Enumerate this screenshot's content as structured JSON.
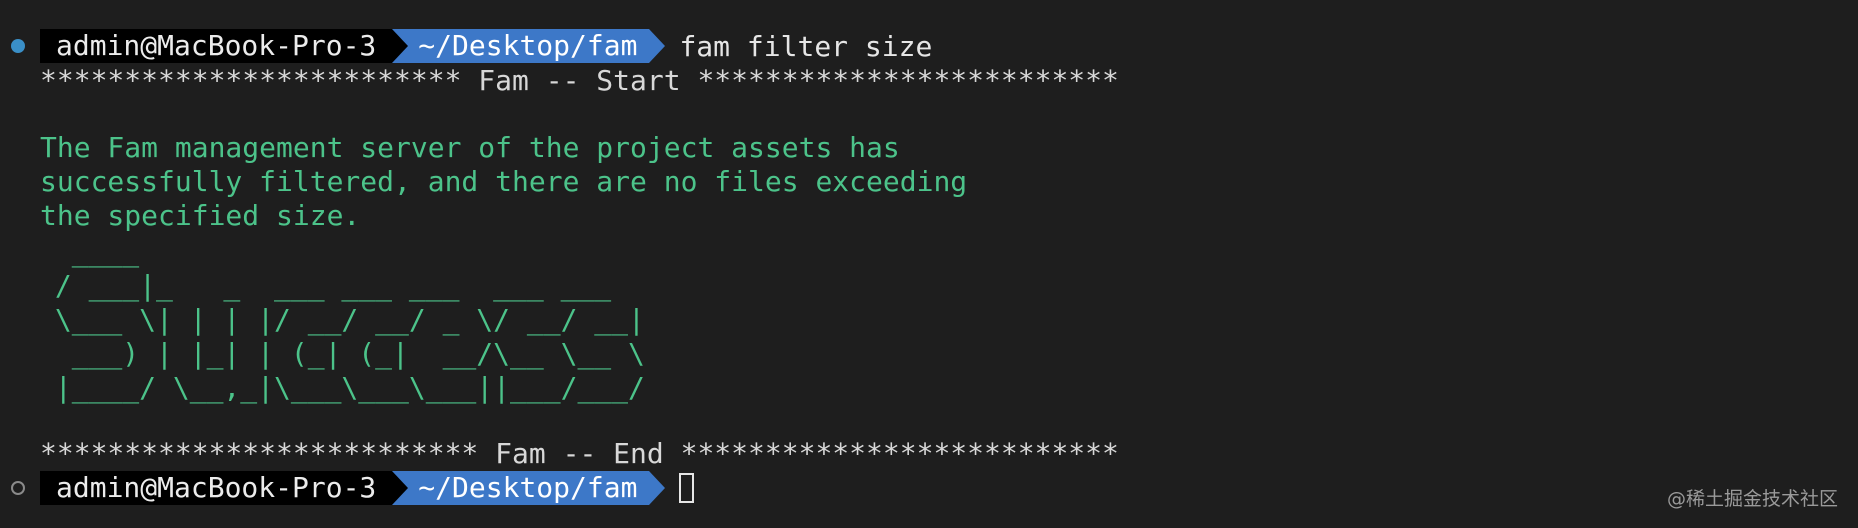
{
  "terminal": {
    "prompt_first": {
      "user_host": "admin@MacBook-Pro-3",
      "path": "~/Desktop/fam",
      "command": "fam filter size"
    },
    "banner_start": "************************* Fam -- Start *************************",
    "message_lines": [
      "The Fam management server of the project assets has",
      "successfully filtered, and there are no files exceeding",
      "the specified size."
    ],
    "ascii_art": [
      "  ____",
      " / ___|_   _  ___ ___ ___  ___ ___",
      " \\___ \\| | | |/ __/ __/ _ \\/ __/ __|",
      "  ___) | |_| | (_| (_|  __/\\__ \\__ \\",
      " |____/ \\__,_|\\___\\___\\___||___/___/"
    ],
    "banner_end": "************************** Fam -- End **************************",
    "prompt_second": {
      "user_host": "admin@MacBook-Pro-3",
      "path": "~/Desktop/fam"
    }
  },
  "watermark": "@稀土掘金技术社区",
  "colors": {
    "background": "#1e1e1e",
    "user_segment": "#000000",
    "path_segment": "#3d78c8",
    "success_green": "#4cc38a",
    "status_dot": "#3a8fc7"
  },
  "icons": {
    "first_gutter": "filled-circle-icon",
    "second_gutter": "hollow-circle-icon"
  }
}
